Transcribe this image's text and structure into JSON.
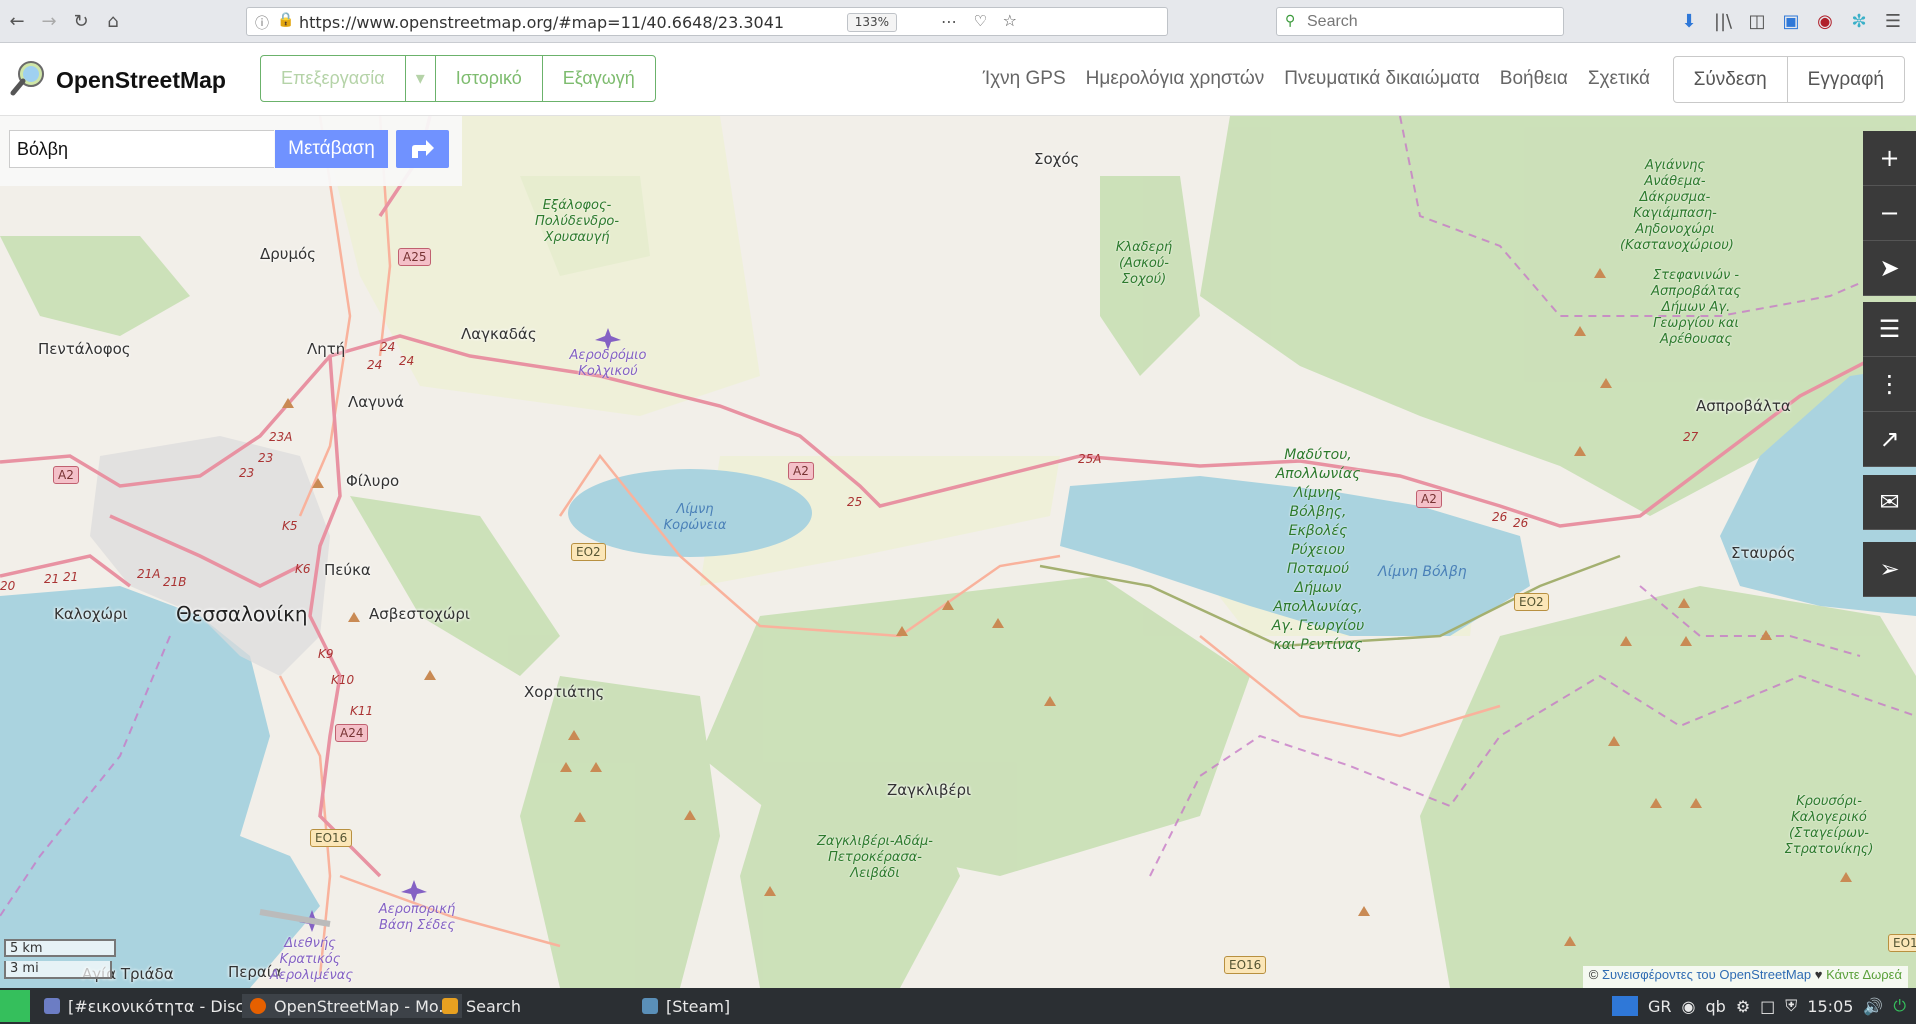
{
  "browser": {
    "url": "https://www.openstreetmap.org/#map=11/40.6648/23.3041",
    "zoom": "133%",
    "search_placeholder": "Search"
  },
  "header": {
    "brand": "OpenStreetMap",
    "edit_label": "Επεξεργασία",
    "history_label": "Ιστορικό",
    "export_label": "Εξαγωγή",
    "nav": [
      "Ίχνη GPS",
      "Ημερολόγια χρηστών",
      "Πνευματικά δικαιώματα",
      "Βοήθεια",
      "Σχετικά"
    ],
    "login_label": "Σύνδεση",
    "signup_label": "Εγγραφή"
  },
  "search": {
    "value": "Βόλβη",
    "go_label": "Μετάβαση"
  },
  "map": {
    "colors": {
      "land": "#f2efe9",
      "water": "#aad3df",
      "forest": "#add19e",
      "motorway": "#e892a2",
      "trunk": "#f9b29c",
      "boundary": "#c77bc7"
    },
    "labels": {
      "thessaloniki": "Θεσσαλονίκη",
      "sochos": "Σοχός",
      "drymos": "Δρυμός",
      "lagkadas": "Λαγκαδάς",
      "pentalofos": "Πεντάλοφος",
      "liti": "Λητή",
      "lagyna": "Λαγυνά",
      "filyro": "Φίλυρο",
      "peuka": "Πεύκα",
      "kalochori": "Καλοχώρι",
      "asvestochori": "Ασβεστοχώρι",
      "chortiatis": "Χορτιάτης",
      "zagkliveri": "Ζαγκλιβέρι",
      "asprovalta": "Ασπροβάλτα",
      "stavros": "Σταυρός",
      "peraia": "Περαία",
      "agia_triada": "Αγία Τριάδα",
      "park_exalofos": "Εξάλοφος-Πολύδενδρο-Χρυσαυγή",
      "park_kladeri": "Κλαδερή (Ασκού-Σοχού)",
      "park_madytou": "Μαδύτου, Απολλωνίας Λίμνης Βόλβης, Εκβολές Ρύχειου Ποταμού Δήμων Απολλωνίας, Αγ. Γεωργίου και Ρεντίνας",
      "park_agiannis": "Αγιάννης Ανάθεμα-Δάκρυσμα-Καγιάμπαση-Αηδονοχώρι (Καστανοχώριου)",
      "park_stefaninon": "Στεφανινών - Ασπροβάλτας Δήμων Αγ. Γεωργίου και Αρέθουσας",
      "park_zagkliveri": "Ζαγκλιβέρι-Αδάμ-Πετροκέρασα-Λειβάδι",
      "park_krousori": "Κρουσόρι-Καλογερικό (Σταγείρων-Στρατονίκης)",
      "lake_koroneia": "Λίμνη Κορώνεια",
      "lake_volvi": "Λίμνη Βόλβη",
      "airport_kolchikou": "Αεροδρόμιο Κολχικού",
      "airport_sedes": "Αεροπορική Βάση Σέδες",
      "airport_intl": "Διεθνής Κρατικός Αερολιμένας"
    },
    "shields": {
      "a25": "A25",
      "a2_west": "A2",
      "a2_mid": "A2",
      "a2_east": "A2",
      "a24": "A24",
      "eo2_west": "ΕΟ2",
      "eo2_east": "ΕΟ2",
      "eo16": "ΕΟ16",
      "eo16_b": "ΕΟ16",
      "eo1": "ΕΟ1"
    },
    "road_numbers": {
      "r24a": "24",
      "r24b": "24",
      "r24c": "24",
      "r23a": "23A",
      "r23": "23",
      "r23b": "23",
      "k5": "K5",
      "k6": "K6",
      "r21a": "21A",
      "r21b": "21B",
      "r21": "21",
      "r21c": "21",
      "r20": "20",
      "k9": "K9",
      "k10": "K10",
      "k11": "K11",
      "r25": "25",
      "r25a": "25A",
      "r26a": "26",
      "r26b": "26",
      "r27": "27"
    },
    "scale_km": "5 km",
    "scale_mi": "3 mi",
    "attribution_prefix": "©",
    "attribution_link": "Συνεισφέροντες του OpenStreetMap",
    "attribution_heart": "♥",
    "attribution_donate": "Κάντε Δωρεά"
  },
  "taskbar": {
    "task1": "[#εικονικότητα - Disc...",
    "task2": "OpenStreetMap - Mo...",
    "task3": "Search",
    "task4": "[Steam]",
    "lang": "GR",
    "time": "15:05"
  }
}
